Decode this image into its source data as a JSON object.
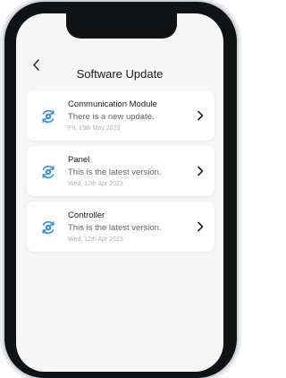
{
  "header": {
    "title": "Software Update",
    "back_icon": "chevron-left-icon"
  },
  "updates": [
    {
      "name": "Communication Module",
      "status": "There is a new update.",
      "date": "Fri, 19th May 2023",
      "icon": "update-cycle-icon"
    },
    {
      "name": "Panel",
      "status": "This is the latest version.",
      "date": "Wed, 12th Apr 2023",
      "icon": "update-cycle-icon"
    },
    {
      "name": "Controller",
      "status": "This is the latest version.",
      "date": "Wed, 12th Apr 2023",
      "icon": "update-cycle-icon"
    }
  ],
  "colors": {
    "accent": "#2f8fe6",
    "background": "#f6f6f7",
    "card": "#ffffff"
  }
}
